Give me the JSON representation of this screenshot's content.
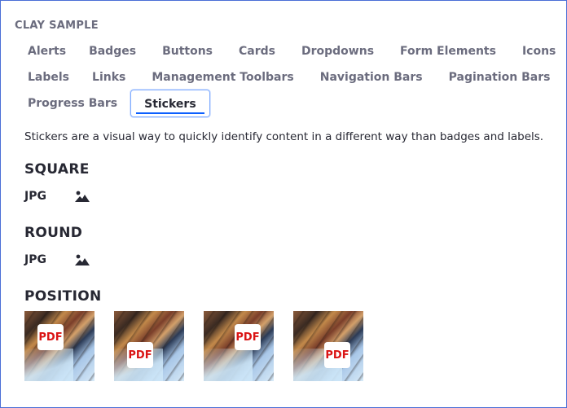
{
  "sample": {
    "title": "CLAY SAMPLE"
  },
  "nav": {
    "row1": [
      "Alerts",
      "Badges",
      "Buttons",
      "Cards",
      "Dropdowns",
      "Form Elements",
      "Icons"
    ],
    "row2": [
      "Labels",
      "Links",
      "Management Toolbars",
      "Navigation Bars",
      "Pagination Bars"
    ],
    "row3": [
      "Progress Bars",
      "Stickers"
    ],
    "active": "Stickers"
  },
  "content": {
    "description": "Stickers are a visual way to quickly identify content in a different way than badges and labels.",
    "sections": {
      "square": {
        "heading": "SQUARE",
        "text": "JPG",
        "icon": "image-icon"
      },
      "round": {
        "heading": "ROUND",
        "text": "JPG",
        "icon": "image-icon"
      },
      "position": {
        "heading": "POSITION",
        "stickers": [
          {
            "label": "PDF",
            "position": "top-left"
          },
          {
            "label": "PDF",
            "position": "bottom-left"
          },
          {
            "label": "PDF",
            "position": "top-right"
          },
          {
            "label": "PDF",
            "position": "bottom-right"
          }
        ]
      }
    }
  },
  "colors": {
    "accent": "#0b5fff",
    "pdf": "#da1414",
    "frame": "#4a6fd6"
  }
}
